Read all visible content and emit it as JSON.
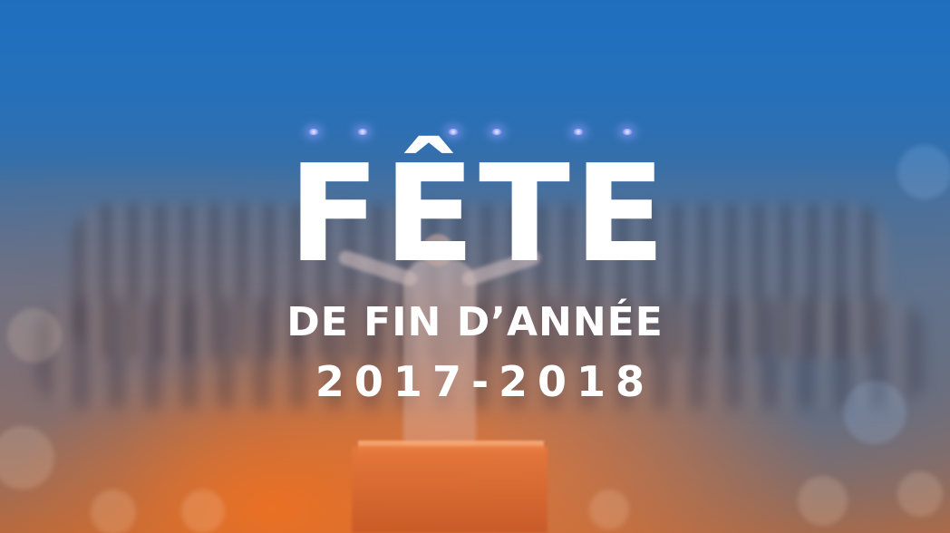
{
  "title": {
    "main": "FÊTE",
    "subtitle": "DE FIN D’ANNÉE",
    "year": "2017-2018"
  },
  "colors": {
    "top_tint": "#1e6ebe",
    "bottom_tint": "#ec7022",
    "text": "#ffffff"
  }
}
